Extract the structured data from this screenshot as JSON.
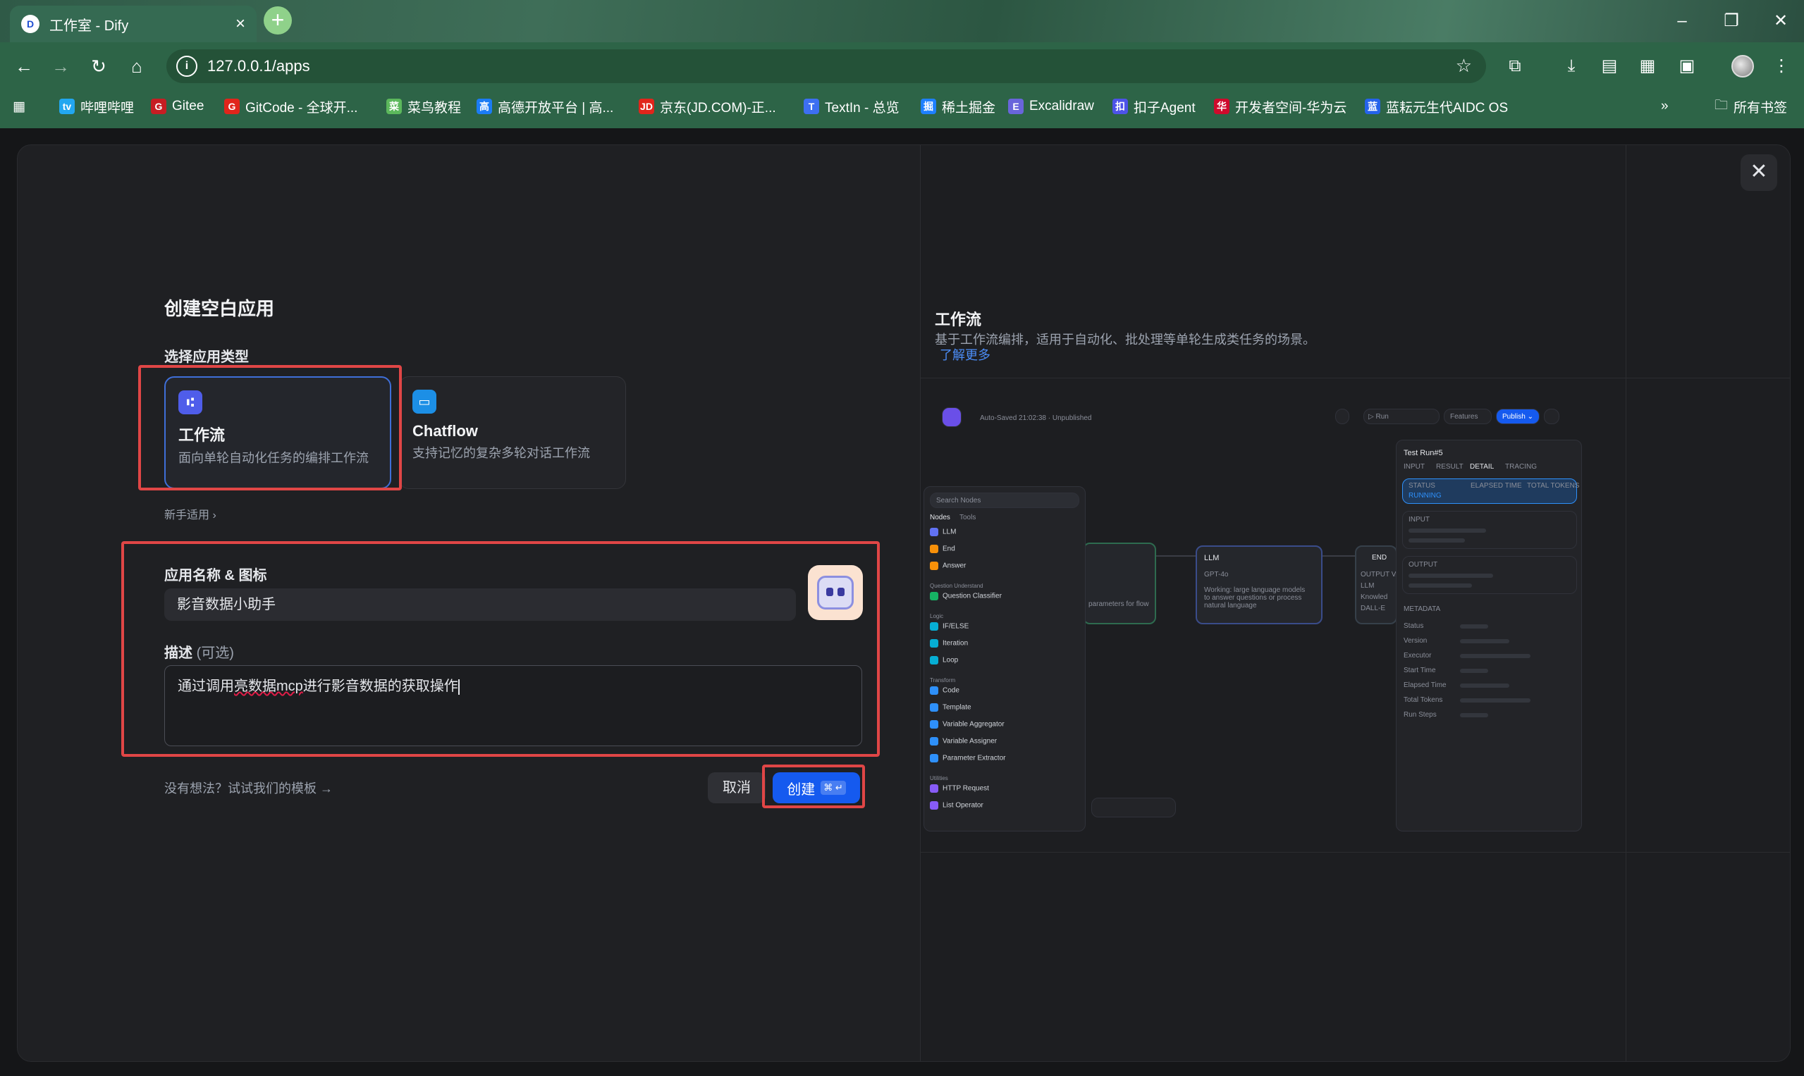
{
  "browser": {
    "tab_title": "工作室 - Dify",
    "tab_favicon": "D",
    "url": "127.0.0.1/apps",
    "bookmarks": [
      {
        "label": "哔哩哔哩",
        "icon": "tv",
        "color": "#22a7f0"
      },
      {
        "label": "Gitee",
        "icon": "G",
        "color": "#c71d23"
      },
      {
        "label": "GitCode - 全球开...",
        "icon": "G",
        "color": "#e1251b"
      },
      {
        "label": "菜鸟教程",
        "icon": "菜",
        "color": "#5cb85c"
      },
      {
        "label": "高德开放平台 | 高...",
        "icon": "高",
        "color": "#1b7cf5"
      },
      {
        "label": "京东(JD.COM)-正...",
        "icon": "JD",
        "color": "#e1251b"
      },
      {
        "label": "TextIn - 总览",
        "icon": "T",
        "color": "#3d6ff2"
      },
      {
        "label": "稀土掘金",
        "icon": "掘",
        "color": "#1e80ff"
      },
      {
        "label": "Excalidraw",
        "icon": "E",
        "color": "#6965db"
      },
      {
        "label": "扣子Agent",
        "icon": "扣",
        "color": "#4d53e8"
      },
      {
        "label": "开发者空间-华为云",
        "icon": "华",
        "color": "#cf0a2c"
      },
      {
        "label": "蓝耘元生代AIDC OS",
        "icon": "蓝",
        "color": "#2563eb"
      }
    ],
    "all_bookmarks_label": "所有书签"
  },
  "modal": {
    "title": "创建空白应用",
    "type_section_label": "选择应用类型",
    "types": [
      {
        "name": "工作流",
        "desc": "面向单轮自动化任务的编排工作流",
        "selected": true
      },
      {
        "name": "Chatflow",
        "desc": "支持记忆的复杂多轮对话工作流",
        "selected": false
      }
    ],
    "beginner_label": "新手适用",
    "name_label": "应用名称 & 图标",
    "name_value": "影音数据小助手",
    "desc_label": "描述",
    "desc_optional": "(可选)",
    "desc_value_before": "通过调用",
    "desc_value_spell": "亮数据mcp",
    "desc_value_after": "进行影音数据的获取操作",
    "template_link": "没有想法？试试我们的模板 →",
    "cancel_label": "取消",
    "create_label": "创建",
    "create_shortcut": "⌘ ↵"
  },
  "preview": {
    "title": "工作流",
    "desc": "基于工作流编排，适用于自动化、批处理等单轮生成类任务的场景。",
    "learn_more": "了解更多",
    "topbar_status": "Auto-Saved 21:02:38 · Unpublished",
    "run_label": "▷ Run",
    "features_label": "Features",
    "publish_label": "Publish ⌄",
    "search_placeholder": "Search Nodes",
    "tabs": [
      "Nodes",
      "Tools"
    ],
    "node_groups": [
      {
        "group": "",
        "items": [
          {
            "label": "LLM",
            "color": "#6172f3"
          },
          {
            "label": "End",
            "color": "#f79009"
          },
          {
            "label": "Answer",
            "color": "#f79009"
          }
        ]
      },
      {
        "group": "Question Understand",
        "items": [
          {
            "label": "Question Classifier",
            "color": "#16b364"
          }
        ]
      },
      {
        "group": "Logic",
        "items": [
          {
            "label": "IF/ELSE",
            "color": "#06aed4"
          },
          {
            "label": "Iteration",
            "color": "#06aed4"
          },
          {
            "label": "Loop",
            "color": "#06aed4"
          }
        ]
      },
      {
        "group": "Transform",
        "items": [
          {
            "label": "Code",
            "color": "#2e90fa"
          },
          {
            "label": "Template",
            "color": "#2e90fa"
          },
          {
            "label": "Variable Aggregator",
            "color": "#2e90fa"
          },
          {
            "label": "Variable Assigner",
            "color": "#2e90fa"
          },
          {
            "label": "Parameter Extractor",
            "color": "#2e90fa"
          }
        ]
      },
      {
        "group": "Utilities",
        "items": [
          {
            "label": "HTTP Request",
            "color": "#875bf7"
          },
          {
            "label": "List Operator",
            "color": "#875bf7"
          }
        ]
      }
    ],
    "llm_node": {
      "title": "LLM",
      "model": "GPT-4o",
      "text": "Working: large language models to answer questions or process natural language"
    },
    "end_node": {
      "title": "END",
      "rows": [
        "OUTPUT VAR",
        "LLM",
        "Knowled",
        "DALL-E"
      ]
    },
    "partial_node_text": "parameters for flow",
    "test_run": {
      "title": "Test Run#5",
      "tabs": [
        "INPUT",
        "RESULT",
        "DETAIL",
        "TRACING"
      ],
      "status_label": "STATUS",
      "status_value": "RUNNING",
      "elapsed_label": "ELAPSED TIME",
      "tokens_label": "TOTAL TOKENS",
      "input_label": "INPUT",
      "output_label": "OUTPUT",
      "metadata_label": "METADATA",
      "meta_rows": [
        "Status",
        "Version",
        "Executor",
        "Start Time",
        "Elapsed Time",
        "Total Tokens",
        "Run Steps"
      ]
    }
  }
}
